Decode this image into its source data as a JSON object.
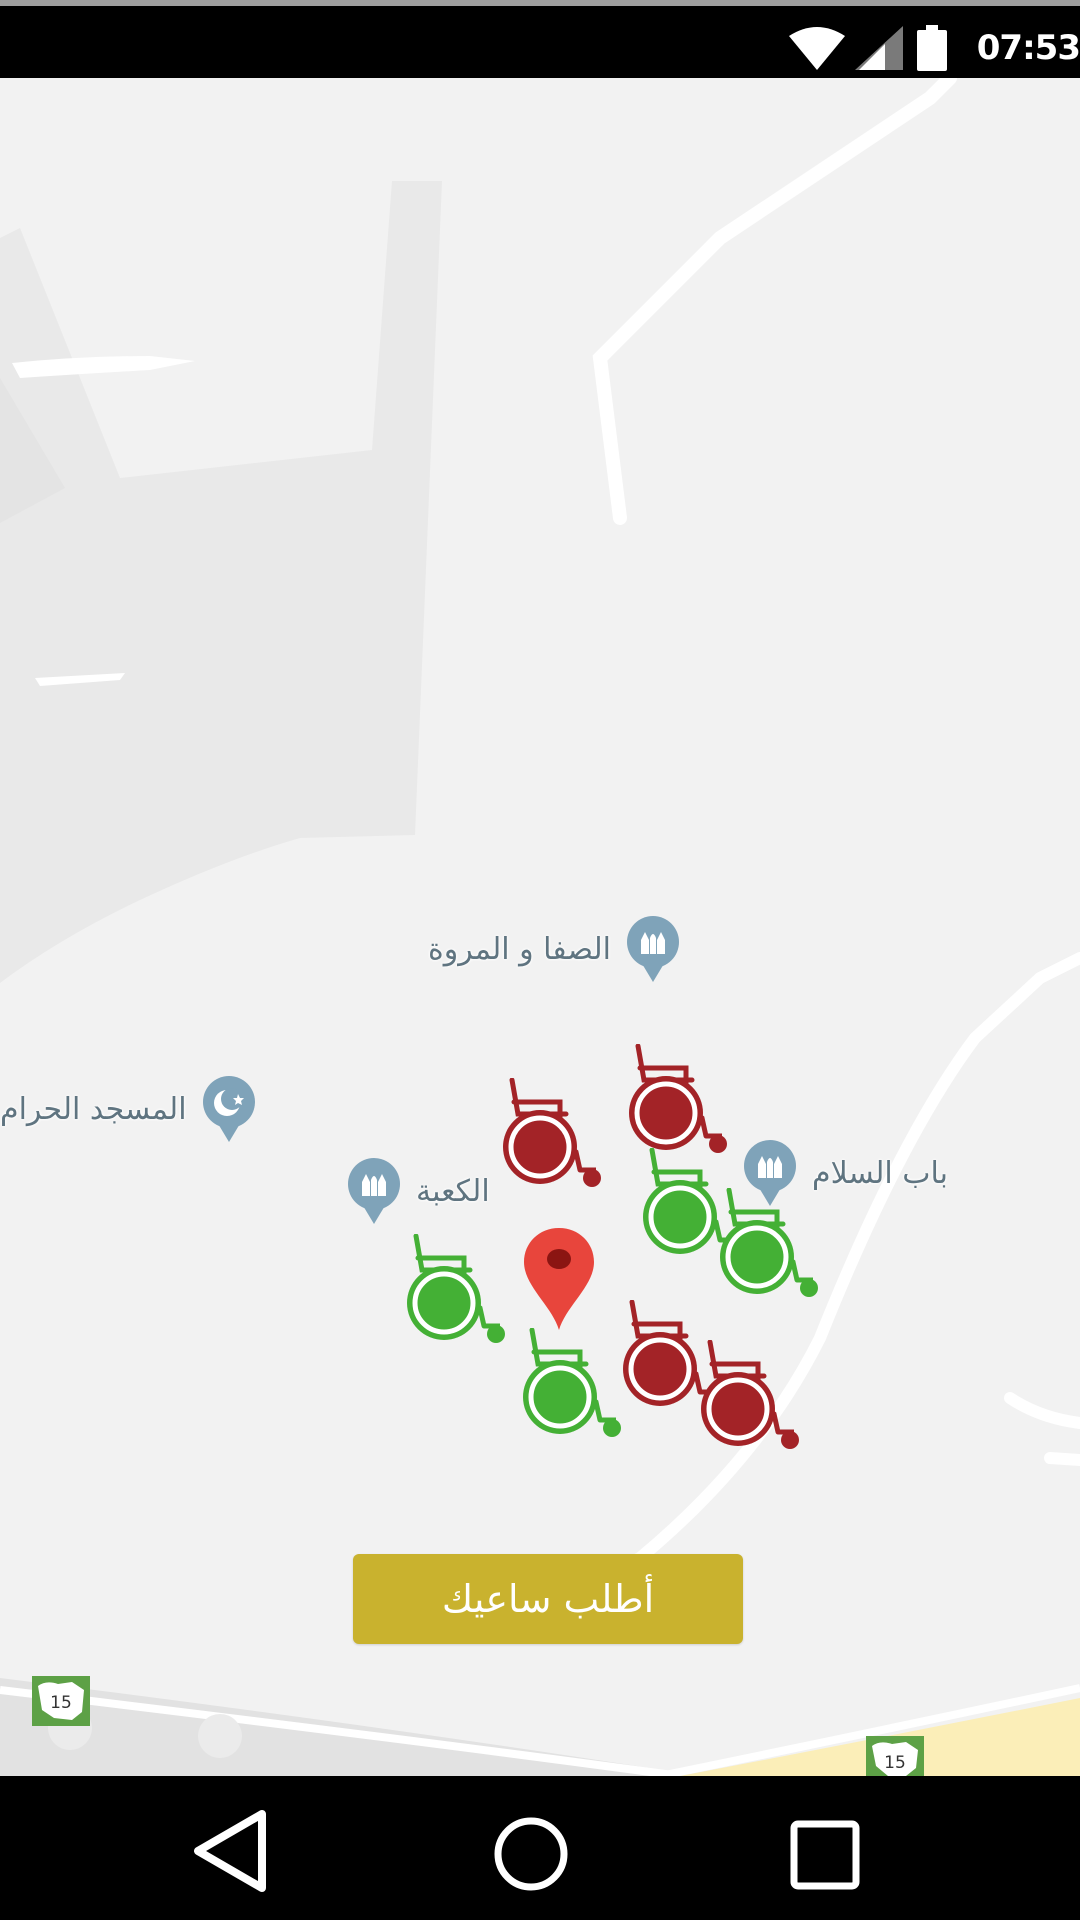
{
  "status_bar": {
    "time": "07:53",
    "icons": [
      "wifi-icon",
      "signal-icon",
      "battery-icon"
    ]
  },
  "map": {
    "pois": [
      {
        "name": "safa-marwa",
        "label": "الصفا و المروة",
        "icon": "mosque-pin-icon"
      },
      {
        "name": "masjid-haram",
        "label": "المسجد الحرام",
        "icon": "crescent-pin-icon"
      },
      {
        "name": "kaaba",
        "label": "الكعبة",
        "icon": "mosque-pin-icon"
      },
      {
        "name": "bab-salam",
        "label": "باب السلام",
        "icon": "mosque-pin-icon"
      }
    ],
    "route_shields": [
      "15",
      "15"
    ],
    "wheelchairs": {
      "available_color": "#44b035",
      "busy_color": "#a32327",
      "available_count": 4,
      "busy_count": 4
    },
    "location_pin_color": "#e8453c"
  },
  "request_button": {
    "label": "أطلب ساعيك",
    "color": "#c9b22e"
  },
  "nav_bar": {
    "buttons": [
      "back-icon",
      "home-icon",
      "recents-icon"
    ]
  }
}
